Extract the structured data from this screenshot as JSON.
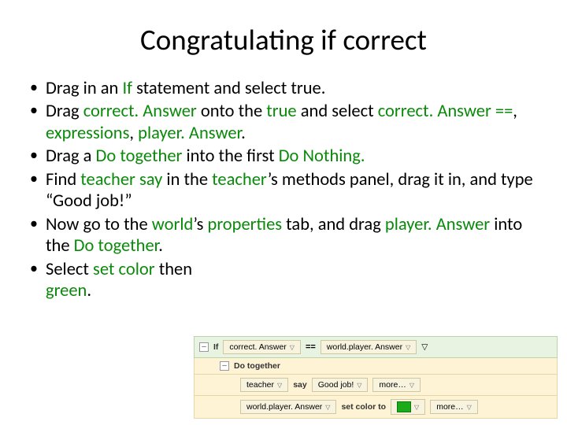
{
  "title": "Congratulating if correct",
  "bullets": {
    "b1": {
      "pre": "Drag in an ",
      "g1": "If",
      "post": " statement and select true."
    },
    "b2": {
      "pre": "Drag ",
      "g1": "correct. Answer",
      "mid1": " onto the ",
      "g2": "true",
      "mid2": " and select ",
      "g3": "correct. Answer ==",
      "mid3": ", ",
      "g4": "expressions",
      "mid4": ", ",
      "g5": "player. Answer",
      "post": "."
    },
    "b3": {
      "pre": "Drag a ",
      "g1": "Do together",
      "mid1": " into the first ",
      "g2": "Do Nothing.",
      "post": ""
    },
    "b4": {
      "pre": "Find ",
      "g1": "teacher say",
      "mid1": " in the ",
      "g2": "teacher",
      "post": "’s methods panel, drag it in, and type “Good job!”"
    },
    "b5": {
      "pre": "Now go to the ",
      "g1": "world",
      "mid1": "’s ",
      "g2": "properties",
      "mid2": " tab, and drag ",
      "g3": "player. Answer",
      "mid3": " into the ",
      "g4": "Do together",
      "post": "."
    },
    "b6": {
      "pre": "Select ",
      "g1": "set color",
      "mid1": " then ",
      "g2": "green",
      "post": "."
    }
  },
  "code": {
    "collapse": "–",
    "if": "If",
    "cond_left": "correct. Answer",
    "cond_op": "==",
    "cond_right": "world.player. Answer",
    "dotogether": "Do together",
    "teacher": "teacher",
    "say": "say",
    "goodjob": "Good job!",
    "more": "more…",
    "playerans": "world.player. Answer",
    "setcolor": "set color to",
    "color_value": "#1aaa1a"
  }
}
